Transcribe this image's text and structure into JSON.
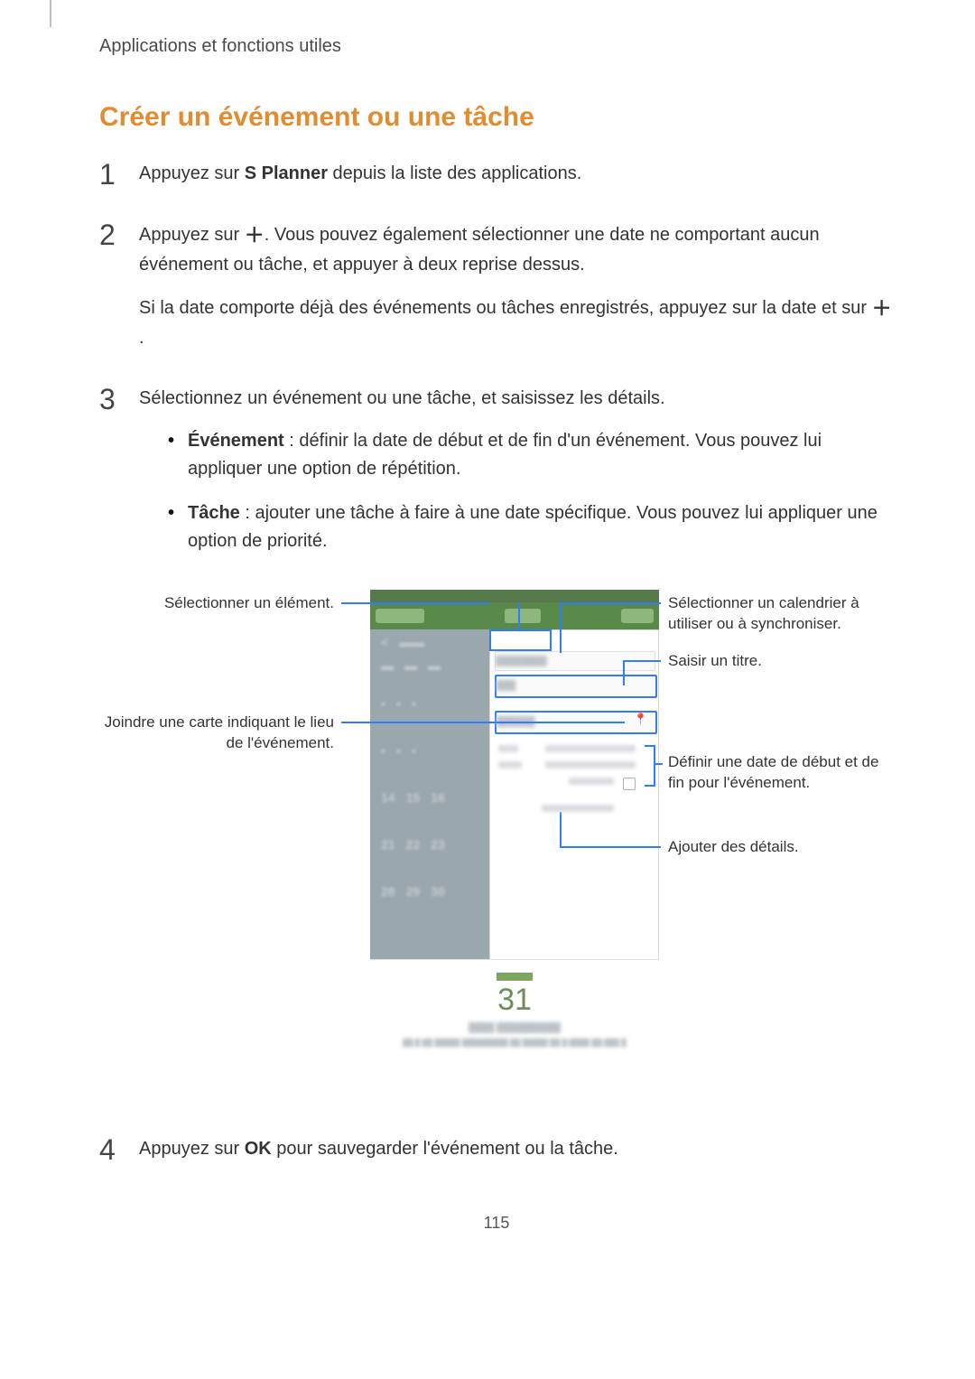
{
  "chapter": "Applications et fonctions utiles",
  "heading": "Créer un événement ou une tâche",
  "step1": {
    "before": "Appuyez sur ",
    "bold": "S Planner",
    "after": " depuis la liste des applications."
  },
  "step2": {
    "p1a": "Appuyez sur ",
    "p1b": ". Vous pouvez également sélectionner une date ne comportant aucun événement ou tâche, et appuyer à deux reprise dessus.",
    "p2a": "Si la date comporte déjà des événements ou tâches enregistrés, appuyez sur la date et sur ",
    "p2b": "."
  },
  "step3": {
    "intro": "Sélectionnez un événement ou une tâche, et saisissez les détails.",
    "b1_bold": "Événement",
    "b1_rest": " : définir la date de début et de fin d'un événement. Vous pouvez lui appliquer une option de répétition.",
    "b2_bold": "Tâche",
    "b2_rest": " : ajouter une tâche à faire à une date spécifique. Vous pouvez lui appliquer une option de priorité."
  },
  "step4": {
    "before": "Appuyez sur ",
    "bold": "OK",
    "after": " pour sauvegarder l'événement ou la tâche."
  },
  "callouts": {
    "left1": "Sélectionner un élément.",
    "left2": "Joindre une carte indiquant le lieu de l'événement.",
    "right1": "Sélectionner un calendrier à utiliser ou à synchroniser.",
    "right2": "Saisir un titre.",
    "right3": "Définir une date de début et de fin pour l'événement.",
    "right4": "Ajouter des détails."
  },
  "figure": {
    "day": "31"
  },
  "plus": "＋",
  "page_number": "115"
}
